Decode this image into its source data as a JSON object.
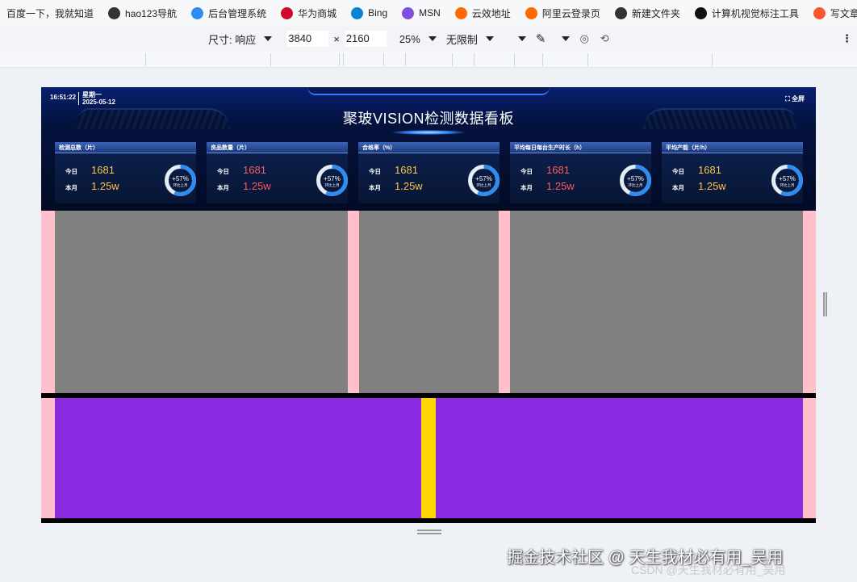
{
  "bookmarks": [
    {
      "label": "百度一下，我就知道",
      "icon": "baidu-icon",
      "color": "#2932e1"
    },
    {
      "label": "hao123导航",
      "icon": "globe-icon",
      "color": "#333333"
    },
    {
      "label": "后台管理系统",
      "icon": "app-icon",
      "color": "#2f8cf0"
    },
    {
      "label": "华为商城",
      "icon": "huawei-icon",
      "color": "#cf0a2c"
    },
    {
      "label": "Bing",
      "icon": "bing-icon",
      "color": "#0a84d0"
    },
    {
      "label": "MSN",
      "icon": "msn-icon",
      "color": "#7f4fe0"
    },
    {
      "label": "云效地址",
      "icon": "aliyun-icon",
      "color": "#ff6a00"
    },
    {
      "label": "阿里云登录页",
      "icon": "aliyun-icon",
      "color": "#ff6a00"
    },
    {
      "label": "新建文件夹",
      "icon": "folder-icon",
      "color": "#333333"
    },
    {
      "label": "计算机视觉标注工具",
      "icon": "arrow-icon",
      "color": "#111111"
    },
    {
      "label": "写文章-C",
      "icon": "csdn-icon",
      "color": "#fc5531"
    }
  ],
  "devtools": {
    "size_label": "尺寸: 响应",
    "width": "3840",
    "times": "×",
    "height": "2160",
    "zoom": "25%",
    "throttle": "无限制"
  },
  "dashboard": {
    "time": "16:51:22",
    "weekday": "星期一",
    "date": "2025-05-12",
    "fullscreen": "⛶ 全屏",
    "title": "聚玻VISION检测数据看板",
    "cards": [
      {
        "title": "检测总数（片）",
        "today_label": "今日",
        "month_label": "本月",
        "today": "1681",
        "month": "1.25w",
        "color": "#ffc34a",
        "ring_pct": "+57%",
        "ring_sub": "环比上月",
        "ring_value": 0.57
      },
      {
        "title": "良品数量（片）",
        "today_label": "今日",
        "month_label": "本月",
        "today": "1681",
        "month": "1.25w",
        "color": "#ff5a5a",
        "ring_pct": "+57%",
        "ring_sub": "环比上月",
        "ring_value": 0.57
      },
      {
        "title": "合格率（%）",
        "today_label": "今日",
        "month_label": "本月",
        "today": "1681",
        "month": "1.25w",
        "color": "#ffc34a",
        "ring_pct": "+57%",
        "ring_sub": "环比上月",
        "ring_value": 0.57
      },
      {
        "title": "平均每日每台生产时长（h）",
        "today_label": "今日",
        "month_label": "本月",
        "today": "1681",
        "month": "1.25w",
        "color": "#ff5a5a",
        "ring_pct": "+57%",
        "ring_sub": "环比上月",
        "ring_value": 0.57
      },
      {
        "title": "平均产能（片/h）",
        "today_label": "今日",
        "month_label": "本月",
        "today": "1681",
        "month": "1.25w",
        "color": "#ffc34a",
        "ring_pct": "+57%",
        "ring_sub": "环比上月",
        "ring_value": 0.57
      }
    ]
  },
  "watermark": "掘金技术社区 @ 天生我材必有用_吴用",
  "csdn": "CSDN @天生我材必有用_吴用"
}
